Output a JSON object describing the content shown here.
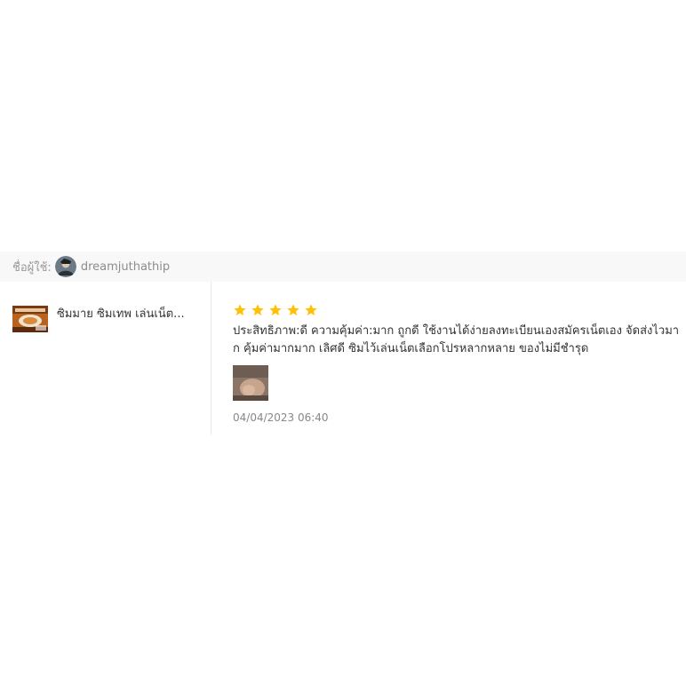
{
  "review": {
    "user_label": "ชื่อผู้ใช้:",
    "username": "dreamjuthathip",
    "product_name": "ซิมมาย ซิมเทพ เล่นเน็ต...",
    "rating": 5,
    "star_color": "#ffc107",
    "text": "ประสิทธิภาพ:ดี ความคุ้มค่า:มาก ถูกดี ใช้งานได้ง่ายลงทะเบียนเองสมัครเน็ตเอง จัดส่งไวมาก คุ้มค่ามากมาก เลิศดี ซิมไว้เล่นเน็ตเลือกโปรหลากหลาย ของไม่มีชำรุด",
    "date": "04/04/2023 06:40"
  }
}
